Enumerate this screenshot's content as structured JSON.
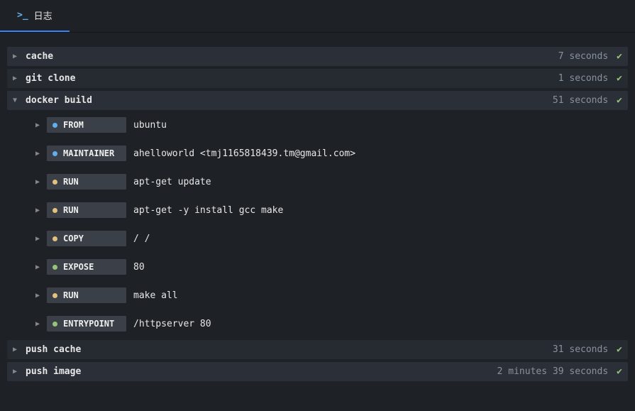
{
  "tab": {
    "label": "日志",
    "prompt": ">_"
  },
  "steps": [
    {
      "name": "cache",
      "time": "7 seconds",
      "expanded": false
    },
    {
      "name": "git clone",
      "time": "1 seconds",
      "expanded": false
    },
    {
      "name": "docker build",
      "time": "51 seconds",
      "expanded": true,
      "children": [
        {
          "cmd": "FROM",
          "dot": "blue",
          "value": "ubuntu"
        },
        {
          "cmd": "MAINTAINER",
          "dot": "blue",
          "value": "ahelloworld <tmj1165818439.tm@gmail.com>"
        },
        {
          "cmd": "RUN",
          "dot": "orange",
          "value": "apt-get update"
        },
        {
          "cmd": "RUN",
          "dot": "orange",
          "value": "apt-get -y install gcc make"
        },
        {
          "cmd": "COPY",
          "dot": "orange",
          "value": "/ /"
        },
        {
          "cmd": "EXPOSE",
          "dot": "green",
          "value": "80"
        },
        {
          "cmd": "RUN",
          "dot": "orange",
          "value": "make all"
        },
        {
          "cmd": "ENTRYPOINT",
          "dot": "green",
          "value": "/httpserver 80"
        }
      ]
    },
    {
      "name": "push cache",
      "time": "31 seconds",
      "expanded": false
    },
    {
      "name": "push image",
      "time": "2 minutes 39 seconds",
      "expanded": false
    }
  ]
}
